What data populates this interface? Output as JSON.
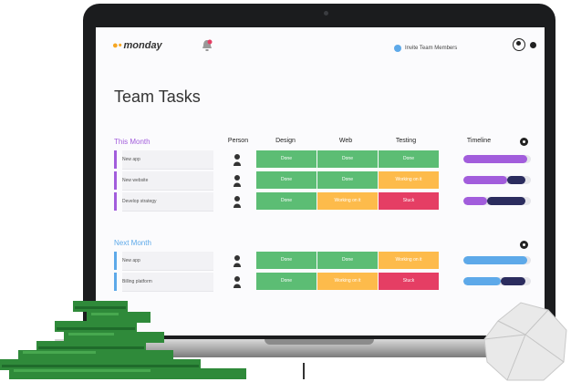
{
  "app": {
    "logo_text": "monday"
  },
  "header": {
    "invite_label": "Invite Team Members"
  },
  "page": {
    "title": "Team Tasks"
  },
  "columns": {
    "person": "Person",
    "design": "Design",
    "web": "Web",
    "testing": "Testing",
    "timeline": "Timeline"
  },
  "colors": {
    "done": "#5cbd74",
    "working": "#fdbb4b",
    "stuck": "#e53e64",
    "this_month": "#a25ddc",
    "next_month": "#5da9e9"
  },
  "groups": [
    {
      "title": "This Month",
      "rows": [
        {
          "name": "New app",
          "design": "Done",
          "web": "Done",
          "testing": "Done",
          "timeline": 0.95
        },
        {
          "name": "New website",
          "design": "Done",
          "web": "Done",
          "testing": "Working on it",
          "timeline": 0.65
        },
        {
          "name": "Develop strategy",
          "design": "Done",
          "web": "Working on it",
          "testing": "Stuck",
          "timeline": 0.35
        }
      ]
    },
    {
      "title": "Next Month",
      "rows": [
        {
          "name": "New app",
          "design": "Done",
          "web": "Done",
          "testing": "Working on it",
          "timeline": 0.95
        },
        {
          "name": "Billing platform",
          "design": "Done",
          "web": "Working on it",
          "testing": "Stuck",
          "timeline": 0.55
        }
      ]
    }
  ]
}
